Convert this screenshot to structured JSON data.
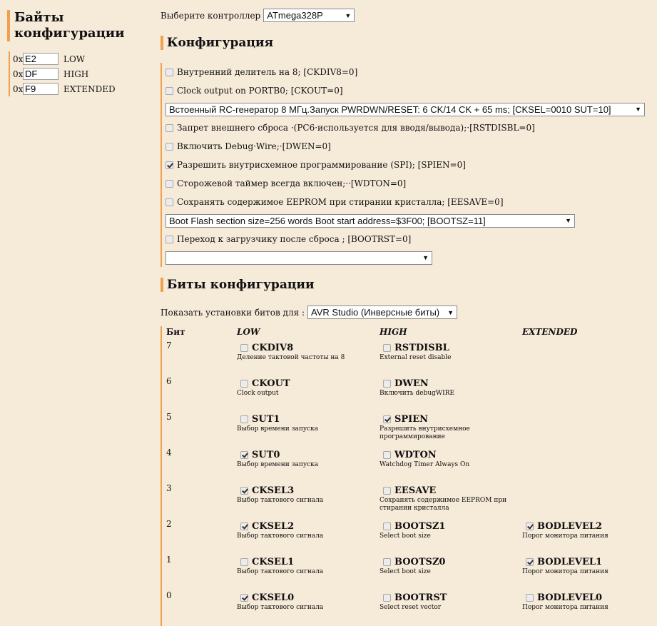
{
  "sidebar": {
    "title_line1": "Байты",
    "title_line2": "конфигурации",
    "prefix": "0x",
    "bytes": [
      {
        "value": "E2",
        "name": "LOW"
      },
      {
        "value": "DF",
        "name": "HIGH"
      },
      {
        "value": "F9",
        "name": "EXTENDED"
      }
    ]
  },
  "controller": {
    "label": "Выберите контроллер",
    "selected": "ATmega328P"
  },
  "config": {
    "title": "Конфигурация",
    "options": [
      {
        "label": "Внутренний делитель на 8; [CKDIV8=0]",
        "checked": false
      },
      {
        "label": "Clock output on PORTB0; [CKOUT=0]",
        "checked": false
      },
      {
        "label": "Запрет внешнего сброса ·(PC6·используется для вводя/вывода);·[RSTDISBL=0]",
        "checked": false
      },
      {
        "label": "Включить Debug·Wire;·[DWEN=0]",
        "checked": false
      },
      {
        "label": "Разрешить внутрисхемное программирование (SPI); [SPIEN=0]",
        "checked": true
      },
      {
        "label": "Сторожевой таймер всегда включен;··[WDTON=0]",
        "checked": false
      },
      {
        "label": "Сохранять содержимое EEPROM при стирании кристалла; [EESAVE=0]",
        "checked": false
      },
      {
        "label": "Переход к загрузчику после сброса ; [BOOTRST=0]",
        "checked": false
      }
    ],
    "clock_select": "Встоенный RC-генератор 8 МГц.Запуск PWRDWN/RESET: 6 CK/14 CK + 65 ms; [CKSEL=0010 SUT=10]",
    "boot_select": "Boot Flash section size=256 words Boot start address=$3F00; [BOOTSZ=11]",
    "bod_select": ""
  },
  "bits": {
    "title": "Биты конфигурации",
    "show_label": "Показать установки битов для :",
    "show_selected": "AVR Studio (Инверсные биты)",
    "head": {
      "bit": "Бит",
      "low": "LOW",
      "high": "HIGH",
      "extended": "EXTENDED"
    },
    "rows": [
      {
        "num": "7",
        "low": {
          "name": "CKDIV8",
          "desc": "Деление тактовой частоты на 8",
          "checked": false
        },
        "high": {
          "name": "RSTDISBL",
          "desc": "External reset disable",
          "checked": false
        },
        "ext": null
      },
      {
        "num": "6",
        "low": {
          "name": "CKOUT",
          "desc": "Clock output",
          "checked": false
        },
        "high": {
          "name": "DWEN",
          "desc": "Включить debugWIRE",
          "checked": false
        },
        "ext": null
      },
      {
        "num": "5",
        "low": {
          "name": "SUT1",
          "desc": "Выбор времени запуска",
          "checked": false
        },
        "high": {
          "name": "SPIEN",
          "desc": "Разрешить внутрисхемное программирование",
          "checked": true
        },
        "ext": null
      },
      {
        "num": "4",
        "low": {
          "name": "SUT0",
          "desc": "Выбор времени запуска",
          "checked": true
        },
        "high": {
          "name": "WDTON",
          "desc": "Watchdog Timer Always On",
          "checked": false
        },
        "ext": null
      },
      {
        "num": "3",
        "low": {
          "name": "CKSEL3",
          "desc": "Выбор тактового сигнала",
          "checked": true
        },
        "high": {
          "name": "EESAVE",
          "desc": "Сохранять содержимое EEPROM при стирании кристалла",
          "checked": false
        },
        "ext": null
      },
      {
        "num": "2",
        "low": {
          "name": "CKSEL2",
          "desc": "Выбор тактового сигнала",
          "checked": true
        },
        "high": {
          "name": "BOOTSZ1",
          "desc": "Select boot size",
          "checked": false
        },
        "ext": {
          "name": "BODLEVEL2",
          "desc": "Порог монитора питания",
          "checked": true
        }
      },
      {
        "num": "1",
        "low": {
          "name": "CKSEL1",
          "desc": "Выбор тактового сигнала",
          "checked": false
        },
        "high": {
          "name": "BOOTSZ0",
          "desc": "Select boot size",
          "checked": false
        },
        "ext": {
          "name": "BODLEVEL1",
          "desc": "Порог монитора питания",
          "checked": true
        }
      },
      {
        "num": "0",
        "low": {
          "name": "CKSEL0",
          "desc": "Выбор тактового сигнала",
          "checked": true
        },
        "high": {
          "name": "BOOTRST",
          "desc": "Select reset vector",
          "checked": false
        },
        "ext": {
          "name": "BODLEVEL0",
          "desc": "Порог монитора питания",
          "checked": false
        }
      }
    ]
  }
}
